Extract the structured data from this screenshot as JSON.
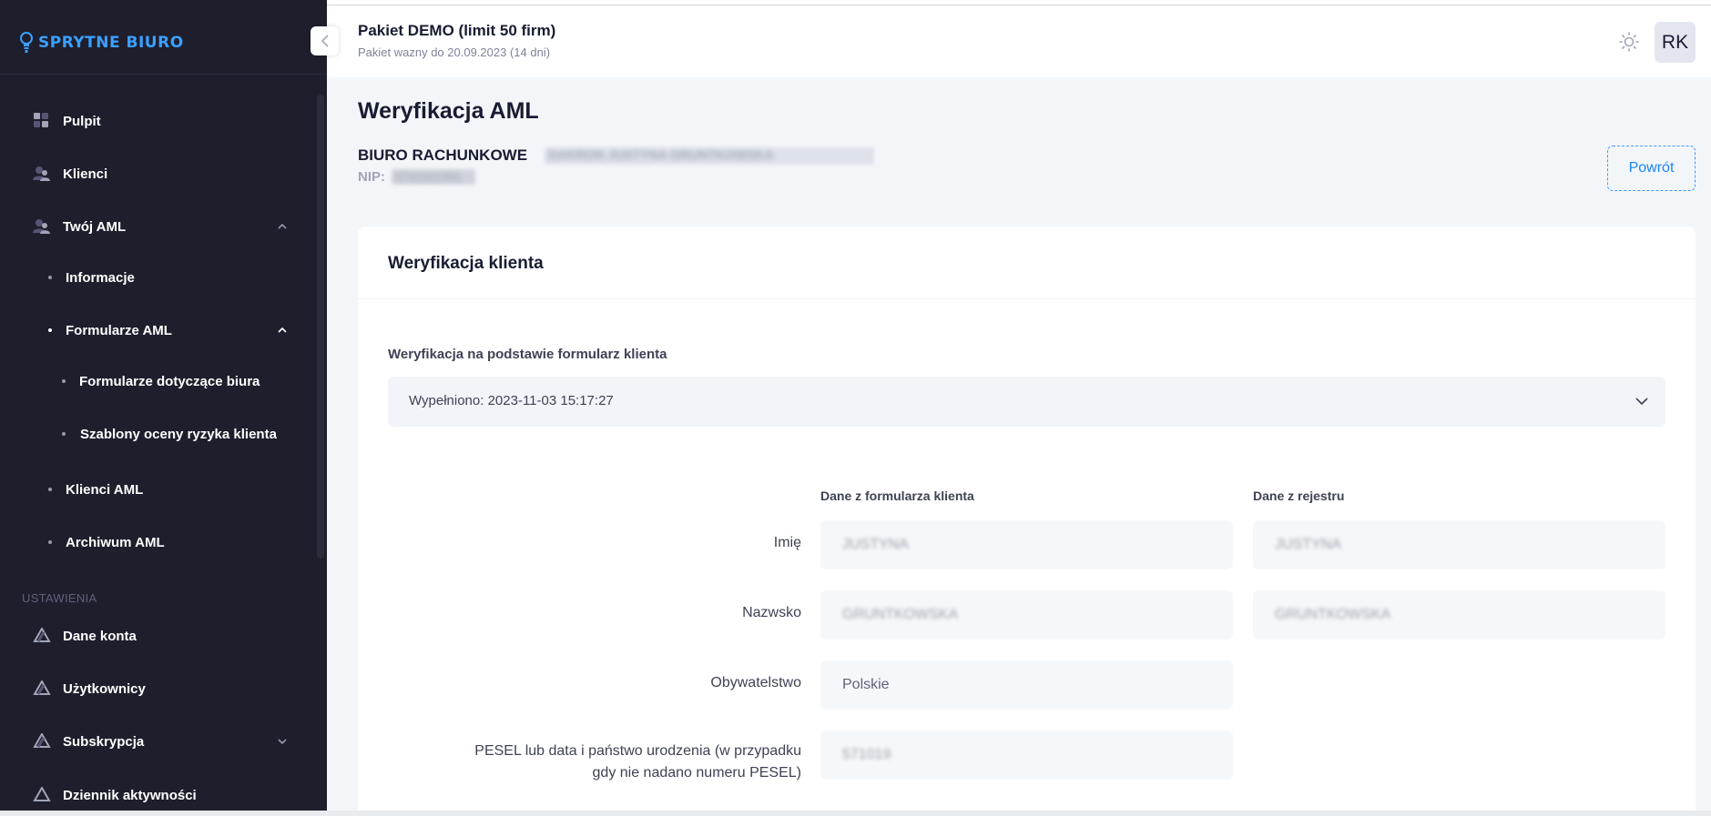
{
  "brand": {
    "name": "SPRYTNE BIURO",
    "color": "#3aa0ff"
  },
  "sidebar": {
    "items": [
      {
        "label": "Pulpit",
        "icon": "dashboard-icon"
      },
      {
        "label": "Klienci",
        "icon": "users-icon"
      },
      {
        "label": "Twój AML",
        "icon": "users-icon",
        "expanded": true
      },
      {
        "label": "Informacje"
      },
      {
        "label": "Formularze AML",
        "expanded": true
      },
      {
        "label": "Formularze dotyczące biura"
      },
      {
        "label": "Szablony oceny ryzyka klienta"
      },
      {
        "label": "Klienci AML"
      },
      {
        "label": "Archiwum AML"
      }
    ],
    "section_title": "USTAWIENIA",
    "settings": [
      {
        "label": "Dane konta",
        "icon": "layers-icon"
      },
      {
        "label": "Użytkownicy",
        "icon": "layers-icon"
      },
      {
        "label": "Subskrypcja",
        "icon": "layers-icon",
        "expanded": false
      },
      {
        "label": "Dziennik aktywności",
        "icon": "layers-icon"
      }
    ]
  },
  "header": {
    "package_title": "Pakiet DEMO (limit 50 firm)",
    "package_sub": "Pakiet wazny do 20.09.2023 (14 dni)",
    "avatar_initials": "RK"
  },
  "page": {
    "title": "Weryfikacja AML",
    "office_name": "BIURO RACHUNKOWE",
    "office_name_rest": "DAKRON JUSTYNA GRUNTKOWSKA",
    "nip_label": "NIP:",
    "nip_value": "5742321591",
    "back_button": "Powrót"
  },
  "card": {
    "title": "Weryfikacja klienta",
    "form_label": "Weryfikacja na podstawie formularz klienta",
    "select_value": "Wypełniono: 2023-11-03 15:17:27",
    "col_form": "Dane z formularza klienta",
    "col_registry": "Dane z rejestru",
    "rows": [
      {
        "label": "Imię",
        "form": "JUSTYNA",
        "registry": "JUSTYNA"
      },
      {
        "label": "Nazwsko",
        "form": "GRUNTKOWSKA",
        "registry": "GRUNTKOWSKA"
      },
      {
        "label": "Obywatelstwo",
        "form": "Polskie",
        "registry": ""
      },
      {
        "label": "PESEL lub data i państwo urodzenia (w przypadku gdy nie nadano numeru PESEL)",
        "form": "571019",
        "registry": ""
      }
    ]
  }
}
